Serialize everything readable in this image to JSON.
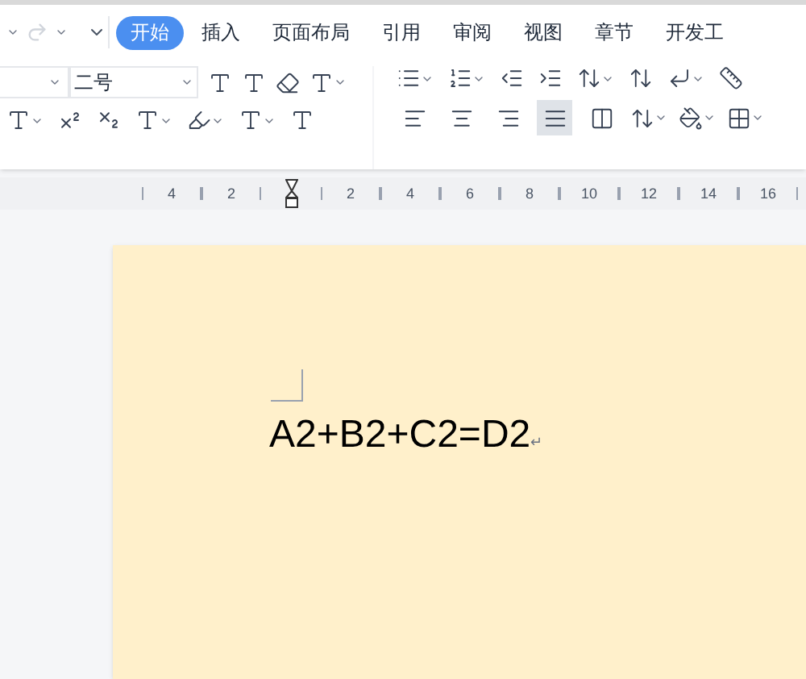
{
  "tabs": [
    {
      "label": "开始",
      "selected": true
    },
    {
      "label": "插入",
      "selected": false
    },
    {
      "label": "页面布局",
      "selected": false
    },
    {
      "label": "引用",
      "selected": false
    },
    {
      "label": "审阅",
      "selected": false
    },
    {
      "label": "视图",
      "selected": false
    },
    {
      "label": "章节",
      "selected": false
    },
    {
      "label": "开发工",
      "selected": false
    }
  ],
  "font_size": {
    "value": "二号"
  },
  "align_buttons": [
    {
      "kind": "left",
      "selected": false
    },
    {
      "kind": "center",
      "selected": false
    },
    {
      "kind": "right",
      "selected": false
    },
    {
      "kind": "justify",
      "selected": true
    },
    {
      "kind": "distributed",
      "selected": false
    }
  ],
  "ruler": {
    "items": [
      {
        "kind": "number",
        "label": "4"
      },
      {
        "kind": "number",
        "label": "2"
      },
      {
        "kind": "indent_marker"
      },
      {
        "kind": "number",
        "label": "2"
      },
      {
        "kind": "number",
        "label": "4"
      },
      {
        "kind": "number",
        "label": "6"
      },
      {
        "kind": "number",
        "label": "8"
      },
      {
        "kind": "number",
        "label": "10"
      },
      {
        "kind": "number",
        "label": "12"
      },
      {
        "kind": "number",
        "label": "14"
      },
      {
        "kind": "number",
        "label": "16"
      }
    ]
  },
  "document": {
    "text": "A2+B2+C2=D2",
    "paragraph_mark": "↵"
  }
}
